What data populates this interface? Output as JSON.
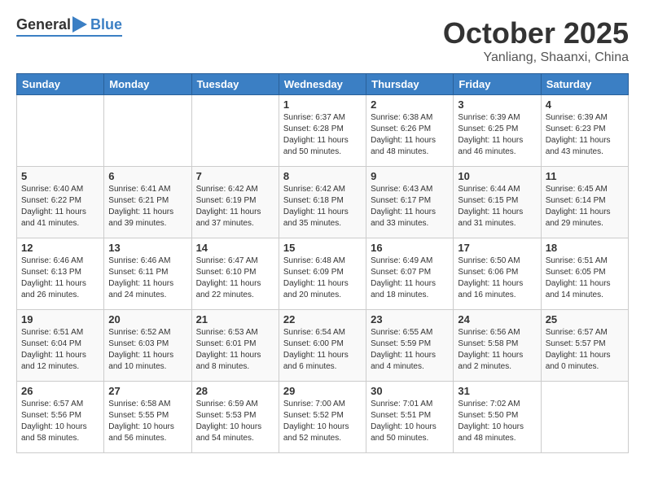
{
  "header": {
    "logo_general": "General",
    "logo_blue": "Blue",
    "month_title": "October 2025",
    "subtitle": "Yanliang, Shaanxi, China"
  },
  "days_of_week": [
    "Sunday",
    "Monday",
    "Tuesday",
    "Wednesday",
    "Thursday",
    "Friday",
    "Saturday"
  ],
  "weeks": [
    [
      {
        "day": "",
        "info": ""
      },
      {
        "day": "",
        "info": ""
      },
      {
        "day": "",
        "info": ""
      },
      {
        "day": "1",
        "info": "Sunrise: 6:37 AM\nSunset: 6:28 PM\nDaylight: 11 hours\nand 50 minutes."
      },
      {
        "day": "2",
        "info": "Sunrise: 6:38 AM\nSunset: 6:26 PM\nDaylight: 11 hours\nand 48 minutes."
      },
      {
        "day": "3",
        "info": "Sunrise: 6:39 AM\nSunset: 6:25 PM\nDaylight: 11 hours\nand 46 minutes."
      },
      {
        "day": "4",
        "info": "Sunrise: 6:39 AM\nSunset: 6:23 PM\nDaylight: 11 hours\nand 43 minutes."
      }
    ],
    [
      {
        "day": "5",
        "info": "Sunrise: 6:40 AM\nSunset: 6:22 PM\nDaylight: 11 hours\nand 41 minutes."
      },
      {
        "day": "6",
        "info": "Sunrise: 6:41 AM\nSunset: 6:21 PM\nDaylight: 11 hours\nand 39 minutes."
      },
      {
        "day": "7",
        "info": "Sunrise: 6:42 AM\nSunset: 6:19 PM\nDaylight: 11 hours\nand 37 minutes."
      },
      {
        "day": "8",
        "info": "Sunrise: 6:42 AM\nSunset: 6:18 PM\nDaylight: 11 hours\nand 35 minutes."
      },
      {
        "day": "9",
        "info": "Sunrise: 6:43 AM\nSunset: 6:17 PM\nDaylight: 11 hours\nand 33 minutes."
      },
      {
        "day": "10",
        "info": "Sunrise: 6:44 AM\nSunset: 6:15 PM\nDaylight: 11 hours\nand 31 minutes."
      },
      {
        "day": "11",
        "info": "Sunrise: 6:45 AM\nSunset: 6:14 PM\nDaylight: 11 hours\nand 29 minutes."
      }
    ],
    [
      {
        "day": "12",
        "info": "Sunrise: 6:46 AM\nSunset: 6:13 PM\nDaylight: 11 hours\nand 26 minutes."
      },
      {
        "day": "13",
        "info": "Sunrise: 6:46 AM\nSunset: 6:11 PM\nDaylight: 11 hours\nand 24 minutes."
      },
      {
        "day": "14",
        "info": "Sunrise: 6:47 AM\nSunset: 6:10 PM\nDaylight: 11 hours\nand 22 minutes."
      },
      {
        "day": "15",
        "info": "Sunrise: 6:48 AM\nSunset: 6:09 PM\nDaylight: 11 hours\nand 20 minutes."
      },
      {
        "day": "16",
        "info": "Sunrise: 6:49 AM\nSunset: 6:07 PM\nDaylight: 11 hours\nand 18 minutes."
      },
      {
        "day": "17",
        "info": "Sunrise: 6:50 AM\nSunset: 6:06 PM\nDaylight: 11 hours\nand 16 minutes."
      },
      {
        "day": "18",
        "info": "Sunrise: 6:51 AM\nSunset: 6:05 PM\nDaylight: 11 hours\nand 14 minutes."
      }
    ],
    [
      {
        "day": "19",
        "info": "Sunrise: 6:51 AM\nSunset: 6:04 PM\nDaylight: 11 hours\nand 12 minutes."
      },
      {
        "day": "20",
        "info": "Sunrise: 6:52 AM\nSunset: 6:03 PM\nDaylight: 11 hours\nand 10 minutes."
      },
      {
        "day": "21",
        "info": "Sunrise: 6:53 AM\nSunset: 6:01 PM\nDaylight: 11 hours\nand 8 minutes."
      },
      {
        "day": "22",
        "info": "Sunrise: 6:54 AM\nSunset: 6:00 PM\nDaylight: 11 hours\nand 6 minutes."
      },
      {
        "day": "23",
        "info": "Sunrise: 6:55 AM\nSunset: 5:59 PM\nDaylight: 11 hours\nand 4 minutes."
      },
      {
        "day": "24",
        "info": "Sunrise: 6:56 AM\nSunset: 5:58 PM\nDaylight: 11 hours\nand 2 minutes."
      },
      {
        "day": "25",
        "info": "Sunrise: 6:57 AM\nSunset: 5:57 PM\nDaylight: 11 hours\nand 0 minutes."
      }
    ],
    [
      {
        "day": "26",
        "info": "Sunrise: 6:57 AM\nSunset: 5:56 PM\nDaylight: 10 hours\nand 58 minutes."
      },
      {
        "day": "27",
        "info": "Sunrise: 6:58 AM\nSunset: 5:55 PM\nDaylight: 10 hours\nand 56 minutes."
      },
      {
        "day": "28",
        "info": "Sunrise: 6:59 AM\nSunset: 5:53 PM\nDaylight: 10 hours\nand 54 minutes."
      },
      {
        "day": "29",
        "info": "Sunrise: 7:00 AM\nSunset: 5:52 PM\nDaylight: 10 hours\nand 52 minutes."
      },
      {
        "day": "30",
        "info": "Sunrise: 7:01 AM\nSunset: 5:51 PM\nDaylight: 10 hours\nand 50 minutes."
      },
      {
        "day": "31",
        "info": "Sunrise: 7:02 AM\nSunset: 5:50 PM\nDaylight: 10 hours\nand 48 minutes."
      },
      {
        "day": "",
        "info": ""
      }
    ]
  ]
}
